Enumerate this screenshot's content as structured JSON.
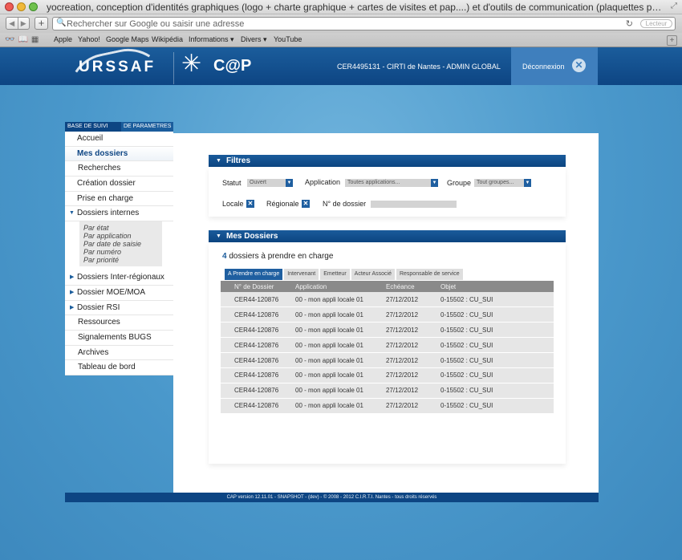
{
  "browser": {
    "window_title": "yocreation, conception d'identités graphiques (logo + charte graphique + cartes de visites et pap....) et d'outils de communication (plaquettes publicitaires, dépliants, flyers, sites internet...)",
    "address_placeholder": "Rechercher sur Google ou saisir une adresse",
    "reader_label": "Lecteur",
    "bookmarks": [
      "Apple",
      "Yahoo!",
      "Google Maps",
      "Wikipédia",
      "Informations ▾",
      "Divers ▾",
      "YouTube"
    ]
  },
  "header": {
    "logo_urssaf": "URSSAF",
    "logo_cap": "C@P",
    "user_info": "CER4495131 - CIRTI de Nantes - ADMIN GLOBAL",
    "logout_label": "Déconnexion"
  },
  "sidebar": {
    "tabs": [
      "BASE DE SUIVI",
      "DE PARAMETRES"
    ],
    "items": [
      {
        "label": "Accueil"
      },
      {
        "label": "Mes dossiers"
      },
      {
        "label": "Recherches"
      },
      {
        "label": "Création dossier"
      },
      {
        "label": "Prise en charge"
      },
      {
        "label": "Dossiers internes"
      },
      {
        "label": "Dossiers Inter-régionaux"
      },
      {
        "label": "Dossier MOE/MOA"
      },
      {
        "label": "Dossier RSI"
      },
      {
        "label": "Ressources"
      },
      {
        "label": "Signalements BUGS"
      },
      {
        "label": "Archives"
      },
      {
        "label": "Tableau de bord"
      }
    ],
    "sub_items": [
      "Par état",
      "Par application",
      "Par date de saisie",
      "Par numéro",
      "Par priorité"
    ]
  },
  "filters": {
    "title": "Filtres",
    "statut_label": "Statut",
    "statut_value": "Ouvert",
    "application_label": "Application",
    "application_value": "Toutes applications...",
    "groupe_label": "Groupe",
    "groupe_value": "Tout groupes...",
    "locale_label": "Locale",
    "regionale_label": "Régionale",
    "dossier_label": "N° de dossier",
    "dossier_value": ""
  },
  "dossiers": {
    "title": "Mes Dossiers",
    "count": "4",
    "count_text": "dossiers à prendre en charge",
    "tabs": [
      "A Prendre en charge",
      "Intervenant",
      "Emetteur",
      "Acteur Associé",
      "Responsable de service"
    ],
    "columns": [
      "N° de Dossier",
      "Application",
      "Echéance",
      "Objet"
    ],
    "rows": [
      [
        "CER44-120876",
        "00 - mon appli locale 01",
        "27/12/2012",
        "0-15502 : CU_SUI"
      ],
      [
        "CER44-120876",
        "00 - mon appli locale 01",
        "27/12/2012",
        "0-15502 : CU_SUI"
      ],
      [
        "CER44-120876",
        "00 - mon appli locale 01",
        "27/12/2012",
        "0-15502 : CU_SUI"
      ],
      [
        "CER44-120876",
        "00 - mon appli locale 01",
        "27/12/2012",
        "0-15502 : CU_SUI"
      ],
      [
        "CER44-120876",
        "00 - mon appli locale 01",
        "27/12/2012",
        "0-15502 : CU_SUI"
      ],
      [
        "CER44-120876",
        "00 - mon appli locale 01",
        "27/12/2012",
        "0-15502 : CU_SUI"
      ],
      [
        "CER44-120876",
        "00 - mon appli locale 01",
        "27/12/2012",
        "0-15502 : CU_SUI"
      ],
      [
        "CER44-120876",
        "00 - mon appli locale 01",
        "27/12/2012",
        "0-15502 : CU_SUI"
      ]
    ]
  },
  "footer": {
    "text": "CAP version 12.11.01 - SNAPSHOT - (dev) - © 2008 - 2012 C.I.R.T.I. Nantes - tous droits réservés"
  },
  "colors": {
    "brand_dark": "#0d4583",
    "brand": "#1b5d9c",
    "background": "#4a94c8"
  }
}
